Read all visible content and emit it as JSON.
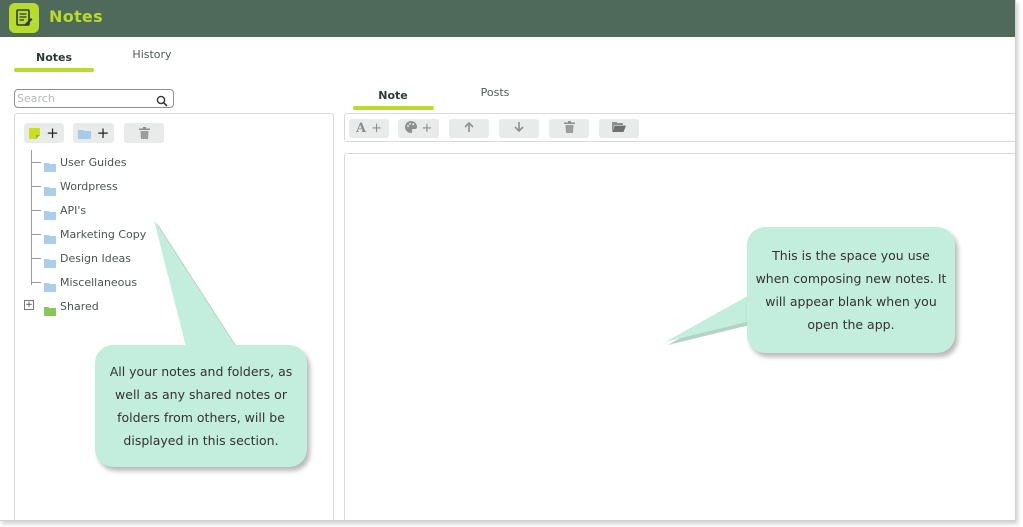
{
  "app": {
    "title": "Notes",
    "brand_color": "#b7dc2b",
    "titlebar_color": "#4f6a5a"
  },
  "main_tabs": [
    {
      "label": "Notes",
      "active": true
    },
    {
      "label": "History",
      "active": false
    }
  ],
  "search": {
    "placeholder": "Search",
    "value": ""
  },
  "left_toolbar": {
    "icons": [
      "new-note-icon",
      "new-folder-icon",
      "trash-icon"
    ]
  },
  "tree": {
    "items": [
      {
        "label": "User Guides",
        "icon": "folder-icon"
      },
      {
        "label": "Wordpress",
        "icon": "folder-icon"
      },
      {
        "label": "API's",
        "icon": "folder-icon"
      },
      {
        "label": "Marketing Copy",
        "icon": "folder-icon"
      },
      {
        "label": "Design Ideas",
        "icon": "folder-icon"
      },
      {
        "label": "Miscellaneous",
        "icon": "folder-icon"
      }
    ],
    "shared": {
      "label": "Shared",
      "icon": "shared-folder-icon"
    }
  },
  "editor_tabs": [
    {
      "label": "Note",
      "active": true
    },
    {
      "label": "Posts",
      "active": false
    }
  ],
  "editor_toolbar": {
    "icons": [
      "font-icon",
      "palette-icon",
      "arrow-up-icon",
      "arrow-down-icon",
      "trash-icon",
      "open-folder-icon"
    ]
  },
  "callouts": {
    "left": "All your notes and folders, as well as any shared notes or folders from others, will be displayed in this section.",
    "right": "This is the space you use when composing new notes. It will appear blank when you open the app."
  }
}
